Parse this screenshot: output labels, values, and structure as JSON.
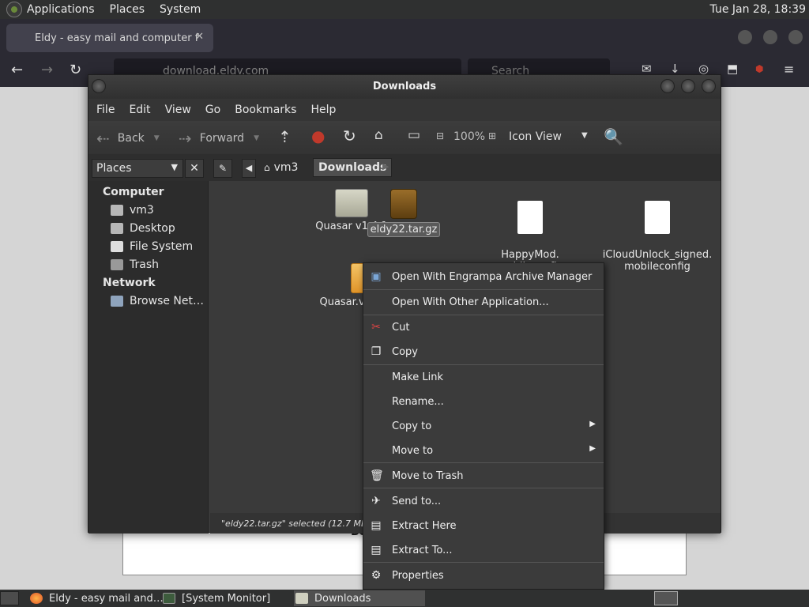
{
  "top_panel": {
    "menus": [
      "Applications",
      "Places",
      "System"
    ],
    "clock": "Tue Jan 28, 18:39"
  },
  "browser": {
    "tab_title": "Eldy - easy mail and computer f",
    "tab_close": "✕",
    "url": "download.eldy.com",
    "search_placeholder": "Search"
  },
  "file_manager": {
    "title": "Downloads",
    "menu": [
      "File",
      "Edit",
      "View",
      "Go",
      "Bookmarks",
      "Help"
    ],
    "toolbar": {
      "back": "Back",
      "forward": "Forward",
      "zoom": "100%",
      "view_mode": "Icon View"
    },
    "places_select": "Places",
    "breadcrumbs": [
      "vm3",
      "Downloads"
    ],
    "sidebar": {
      "computer_header": "Computer",
      "computer_items": [
        "vm3",
        "Desktop",
        "File System",
        "Trash"
      ],
      "network_header": "Network",
      "network_items": [
        "Browse Net…"
      ]
    },
    "files": [
      {
        "name": "Quasar v1.4.1",
        "type": "folder"
      },
      {
        "name": "eldy22.tar.gz",
        "type": "archive",
        "selected": true
      },
      {
        "name": "HappyMod.\nmobileconfig",
        "type": "document"
      },
      {
        "name": "iCloudUnlock_signed.\nmobileconfig",
        "type": "document"
      },
      {
        "name": "Quasar.v1.4.1.zip",
        "type": "zip"
      }
    ],
    "status": "\"eldy22.tar.gz\" selected (12.7 MB), Fr"
  },
  "context_menu": {
    "items": [
      {
        "label": "Open With Engrampa Archive Manager",
        "icon": "archive-manager-icon"
      },
      {
        "label": "Open With Other Application...",
        "icon": ""
      },
      {
        "label": "Cut",
        "icon": "scissors-icon"
      },
      {
        "label": "Copy",
        "icon": "copy-icon"
      },
      {
        "label": "Make Link",
        "icon": ""
      },
      {
        "label": "Rename...",
        "icon": ""
      },
      {
        "label": "Copy to",
        "icon": "",
        "submenu": true
      },
      {
        "label": "Move to",
        "icon": "",
        "submenu": true
      },
      {
        "label": "Move to Trash",
        "icon": "trash-icon"
      },
      {
        "label": "Send to...",
        "icon": "send-icon"
      },
      {
        "label": "Extract Here",
        "icon": "extract-icon"
      },
      {
        "label": "Extract To...",
        "icon": "extract-icon"
      },
      {
        "label": "Properties",
        "icon": "properties-icon"
      }
    ]
  },
  "taskbar": {
    "tasks": [
      "Eldy - easy mail and…",
      "[System Monitor]",
      "Downloads"
    ]
  },
  "page_fragment": "Bo"
}
